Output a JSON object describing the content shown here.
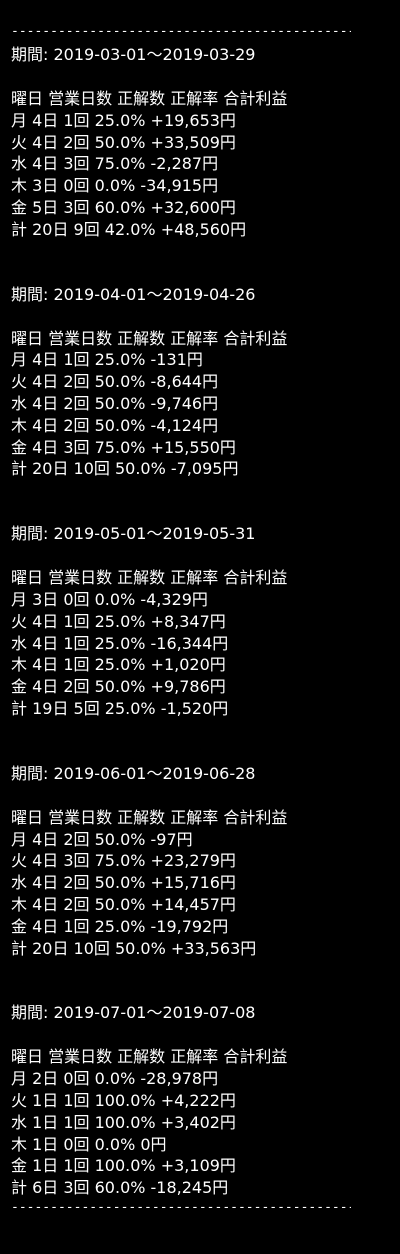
{
  "rule": "-----------------------------------------------------",
  "header": "曜日 営業日数 正解数 正解率 合計利益",
  "periods": [
    {
      "label": "期間: 2019-03-01～2019-03-29",
      "rows": [
        "月 4日 1回 25.0% +19,653円",
        "火 4日 2回 50.0% +33,509円",
        "水 4日 3回 75.0% -2,287円",
        "木 3日 0回 0.0% -34,915円",
        "金 5日 3回 60.0% +32,600円",
        "計 20日 9回 42.0% +48,560円"
      ]
    },
    {
      "label": "期間: 2019-04-01～2019-04-26",
      "rows": [
        "月 4日 1回 25.0% -131円",
        "火 4日 2回 50.0% -8,644円",
        "水 4日 2回 50.0% -9,746円",
        "木 4日 2回 50.0% -4,124円",
        "金 4日 3回 75.0% +15,550円",
        "計 20日 10回 50.0% -7,095円"
      ]
    },
    {
      "label": "期間: 2019-05-01～2019-05-31",
      "rows": [
        "月 3日 0回 0.0% -4,329円",
        "火 4日 1回 25.0% +8,347円",
        "水 4日 1回 25.0% -16,344円",
        "木 4日 1回 25.0% +1,020円",
        "金 4日 2回 50.0% +9,786円",
        "計 19日 5回 25.0% -1,520円"
      ]
    },
    {
      "label": "期間: 2019-06-01～2019-06-28",
      "rows": [
        "月 4日 2回 50.0% -97円",
        "火 4日 3回 75.0% +23,279円",
        "水 4日 2回 50.0% +15,716円",
        "木 4日 2回 50.0% +14,457円",
        "金 4日 1回 25.0% -19,792円",
        "計 20日 10回 50.0% +33,563円"
      ]
    },
    {
      "label": "期間: 2019-07-01～2019-07-08",
      "rows": [
        "月 2日 0回 0.0% -28,978円",
        "火 1日 1回 100.0% +4,222円",
        "水 1日 1回 100.0% +3,402円",
        "木 1日 0回 0.0% 0円",
        "金 1日 1回 100.0% +3,109円",
        "計 6日 3回 60.0% -18,245円"
      ]
    }
  ]
}
